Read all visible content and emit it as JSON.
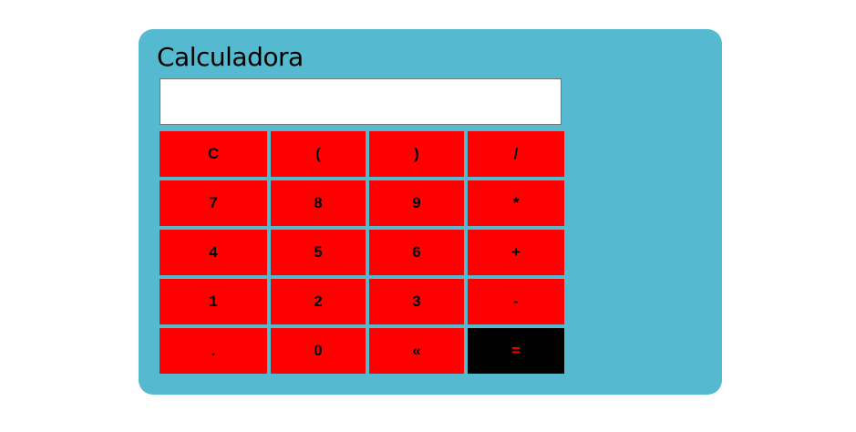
{
  "app": {
    "title": "Calculadora"
  },
  "display": {
    "value": "",
    "placeholder": ""
  },
  "keys": [
    {
      "label": "C"
    },
    {
      "label": "("
    },
    {
      "label": ")"
    },
    {
      "label": "/"
    },
    {
      "label": "7"
    },
    {
      "label": "8"
    },
    {
      "label": "9"
    },
    {
      "label": "*"
    },
    {
      "label": "4"
    },
    {
      "label": "5"
    },
    {
      "label": "6"
    },
    {
      "label": "+"
    },
    {
      "label": "1"
    },
    {
      "label": "2"
    },
    {
      "label": "3"
    },
    {
      "label": "-"
    },
    {
      "label": "."
    },
    {
      "label": "0"
    },
    {
      "label": "«"
    },
    {
      "label": "="
    }
  ],
  "colors": {
    "card_background": "#55b9d0",
    "key_background": "#ff0000",
    "key_text": "#000000",
    "equals_background": "#000000",
    "equals_text": "#ff0000"
  }
}
